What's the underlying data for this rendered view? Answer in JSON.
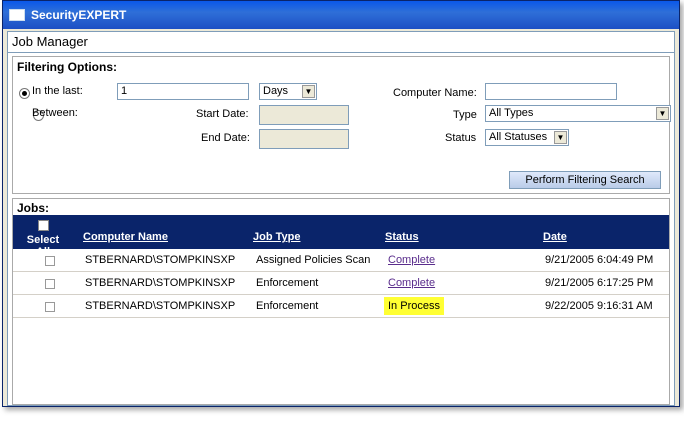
{
  "window": {
    "title": "SecurityEXPERT"
  },
  "header": {
    "title": "Job Manager"
  },
  "filter": {
    "title": "Filtering Options:",
    "in_last_label": "In the last:",
    "in_last_value": "1",
    "unit_value": "Days",
    "between_label": "Between:",
    "start_date_label": "Start Date:",
    "end_date_label": "End Date:",
    "computer_name_label": "Computer Name:",
    "computer_name_value": "",
    "type_label": "Type",
    "type_value": "All Types",
    "status_label": "Status",
    "status_value": "All Statuses",
    "search_button": "Perform Filtering Search"
  },
  "jobs": {
    "title": "Jobs:",
    "columns": {
      "select_all": "Select All",
      "computer_name": "Computer Name",
      "job_type": "Job Type",
      "status": "Status",
      "date": "Date"
    },
    "rows": [
      {
        "computer": "STBERNARD\\STOMPKINSXP",
        "type": "Assigned Policies Scan",
        "status": "Complete",
        "date": "9/21/2005 6:04:49 PM"
      },
      {
        "computer": "STBERNARD\\STOMPKINSXP",
        "type": "Enforcement",
        "status": "Complete",
        "date": "9/21/2005 6:17:25 PM"
      },
      {
        "computer": "STBERNARD\\STOMPKINSXP",
        "type": "Enforcement",
        "status": "In Process",
        "date": "9/22/2005 9:16:31 AM"
      }
    ]
  },
  "colors": {
    "titlebar": "#0a58ea",
    "grid_header": "#0a246a",
    "in_process_highlight": "#ffff33",
    "link": "#5a2d8c"
  }
}
